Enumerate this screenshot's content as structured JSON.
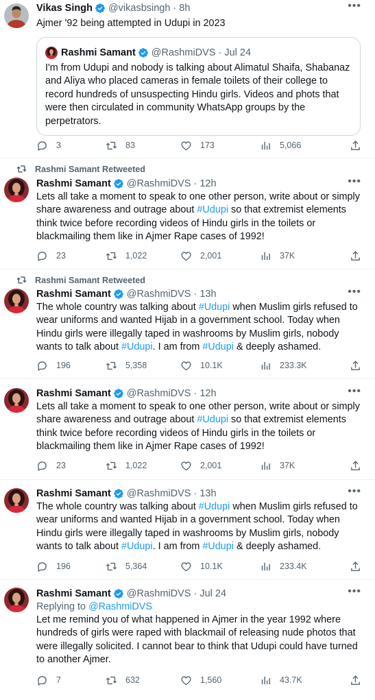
{
  "colors": {
    "link": "#1d9bf0",
    "muted": "#536471",
    "verified": "#1d9bf0",
    "border": "#eff3f4"
  },
  "tweets": [
    {
      "name": "Vikas Singh",
      "handle": "@vikasbsingh",
      "time": "8h",
      "text": "Ajmer '92 being attempted in Udupi in 2023",
      "quote": {
        "name": "Rashmi Samant",
        "handle": "@RashmiDVS",
        "time": "Jul 24",
        "text": "I'm from Udupi and nobody is talking about Alimatul Shaifa, Shabanaz and Aliya who placed cameras in female toilets of their college to record hundreds of unsuspecting Hindu girls. Videos and phots that were then circulated in community WhatsApp groups by the perpetrators."
      },
      "replies": "3",
      "retweets": "83",
      "likes": "173",
      "views": "5,066"
    },
    {
      "retweeted_by": "Rashmi Samant Retweeted",
      "name": "Rashmi Samant",
      "handle": "@RashmiDVS",
      "time": "12h",
      "text_before": "Lets all take a moment to speak to one other person, write about or simply share awareness and outrage about ",
      "hashtag": "#Udupi",
      "text_after": " so that extremist elements think twice before recording videos of Hindu girls in the toilets or blackmailing them like in Ajmer Rape cases of 1992!",
      "replies": "23",
      "retweets": "1,022",
      "likes": "2,001",
      "views": "37K"
    },
    {
      "retweeted_by": "Rashmi Samant Retweeted",
      "name": "Rashmi Samant",
      "handle": "@RashmiDVS",
      "time": "13h",
      "p1": "The whole country was talking about ",
      "tag1": "#Udupi",
      "p2": " when Muslim girls refused to wear uniforms and wanted Hijab in a government school. Today when Hindu girls were illegally taped in washrooms by Muslim girls, nobody wants to talk about ",
      "tag2": "#Udupi",
      "p3": ". I am from ",
      "tag3": "#Udupi",
      "p4": " & deeply ashamed.",
      "replies": "196",
      "retweets": "5,358",
      "likes": "10.1K",
      "views": "233.3K"
    },
    {
      "name": "Rashmi Samant",
      "handle": "@RashmiDVS",
      "time": "12h",
      "text_before": "Lets all take a moment to speak to one other person, write about or simply share awareness and outrage about ",
      "hashtag": "#Udupi",
      "text_after": " so that extremist elements think twice before recording videos of Hindu girls in the toilets or blackmailing them like in Ajmer Rape cases of 1992!",
      "replies": "23",
      "retweets": "1,022",
      "likes": "2,001",
      "views": "37K"
    },
    {
      "name": "Rashmi Samant",
      "handle": "@RashmiDVS",
      "time": "13h",
      "p1": "The whole country was talking about ",
      "tag1": "#Udupi",
      "p2": " when Muslim girls refused to wear uniforms and wanted Hijab in a government school. Today when Hindu girls were illegally taped in washrooms by Muslim girls, nobody wants to talk about ",
      "tag2": "#Udupi",
      "p3": ". I am from ",
      "tag3": "#Udupi",
      "p4": " & deeply ashamed.",
      "replies": "196",
      "retweets": "5,364",
      "likes": "10.1K",
      "views": "233.4K"
    },
    {
      "name": "Rashmi Samant",
      "handle": "@RashmiDVS",
      "time": "Jul 24",
      "replying_prefix": "Replying to ",
      "replying_to": "@RashmiDVS",
      "text": "Let me remind you of what happened in Ajmer in the year 1992 where hundreds of girls were raped with blackmail of releasing nude photos that were illegally solicited. I cannot bear to think that Udupi could have turned to another Ajmer.",
      "replies": "7",
      "retweets": "632",
      "likes": "1,560",
      "views": "43.7K"
    }
  ],
  "ui": {
    "dot": "·",
    "more": "•••"
  }
}
